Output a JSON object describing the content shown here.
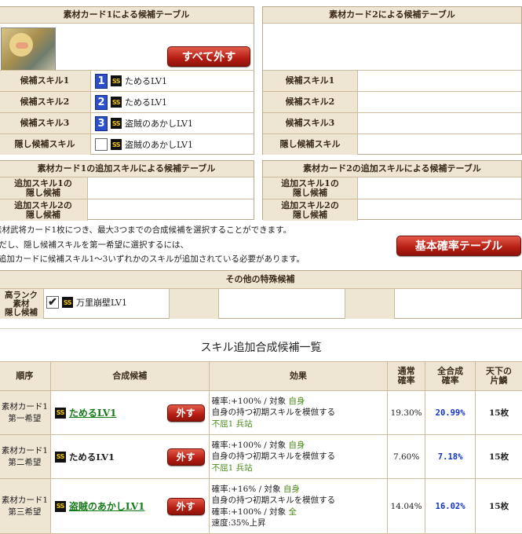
{
  "card1": {
    "title": "素材カード1による候補テーブル",
    "remove_all": "すべて外す",
    "rows": [
      {
        "label": "候補スキル1",
        "num": "1",
        "skill": "ためるLV1"
      },
      {
        "label": "候補スキル2",
        "num": "2",
        "skill": "ためるLV1"
      },
      {
        "label": "候補スキル3",
        "num": "3",
        "skill": "盗賊のあかしLV1"
      },
      {
        "label": "隠し候補スキル",
        "num": "",
        "skill": "盗賊のあかしLV1"
      }
    ]
  },
  "card2": {
    "title": "素材カード2による候補テーブル",
    "rows": [
      {
        "label": "候補スキル1"
      },
      {
        "label": "候補スキル2"
      },
      {
        "label": "候補スキル3"
      },
      {
        "label": "隠し候補スキル"
      }
    ]
  },
  "add1": {
    "title": "素材カード1の追加スキルによる候補テーブル",
    "rows": [
      {
        "label1": "追加スキル1の",
        "label2": "隠し候補"
      },
      {
        "label1": "追加スキル2の",
        "label2": "隠し候補"
      }
    ]
  },
  "add2": {
    "title": "素材カード2の追加スキルによる候補テーブル",
    "rows": [
      {
        "label1": "追加スキル1の",
        "label2": "隠し候補"
      },
      {
        "label1": "追加スキル2の",
        "label2": "隠し候補"
      }
    ]
  },
  "notes": [
    "素材武将カード1枚につき、最大3つまでの合成候補を選択することができます。",
    "ただし、隠し候補スキルを第一希望に選択するには、",
    "追加カードに候補スキル1～3いずれかのスキルが追加されている必要があります。"
  ],
  "basic_prob_button": "基本確率テーブル",
  "special": {
    "title": "その他の特殊候補",
    "label": [
      "高ランク",
      "素材",
      "隠し候補"
    ],
    "skill": "万里崩壁LV1"
  },
  "list": {
    "title": "スキル追加合成候補一覧",
    "headers": {
      "order": "順序",
      "candidate": "合成候補",
      "effect": "効果",
      "normal": [
        "通常",
        "確率"
      ],
      "full": [
        "全合成",
        "確率"
      ],
      "tenka": [
        "天下の",
        "片鱗"
      ]
    },
    "remove_label": "外す",
    "rows": [
      {
        "order1": "素材カード1",
        "order2": "第一希望",
        "skill": "ためるLV1",
        "linked": true,
        "effects": [
          {
            "a": "確率:+100%  /  対象  ",
            "g": "自身"
          },
          {
            "a": "自身の持つ初期スキルを模倣する",
            "g": ""
          },
          {
            "a": "",
            "g": "不屈1  兵站"
          }
        ],
        "normal": "19.30%",
        "full": "20.99%",
        "tenka": "15枚"
      },
      {
        "order1": "素材カード1",
        "order2": "第二希望",
        "skill": "ためるLV1",
        "linked": false,
        "effects": [
          {
            "a": "確率:+100%  /  対象  ",
            "g": "自身"
          },
          {
            "a": "自身の持つ初期スキルを模倣する",
            "g": ""
          },
          {
            "a": "",
            "g": "不屈1  兵站"
          }
        ],
        "normal": "7.60%",
        "full": "7.18%",
        "tenka": "15枚"
      },
      {
        "order1": "素材カード1",
        "order2": "第三希望",
        "skill": "盗賊のあかしLV1",
        "linked": true,
        "effects": [
          {
            "a": "確率:+16%  /  対象  ",
            "g": "自身"
          },
          {
            "a": "自身の持つ初期スキルを模倣する",
            "g": ""
          },
          {
            "a": "確率:+100%  /  対象  ",
            "g": "全"
          },
          {
            "a": "速度:35%上昇",
            "g": ""
          }
        ],
        "normal": "14.04%",
        "full": "16.02%",
        "tenka": "15枚"
      }
    ]
  },
  "colors": {
    "accent_red": "#b51d12",
    "header_bg": "#efe5d3",
    "link_green": "#157a18",
    "prob_blue": "#1234c6"
  }
}
